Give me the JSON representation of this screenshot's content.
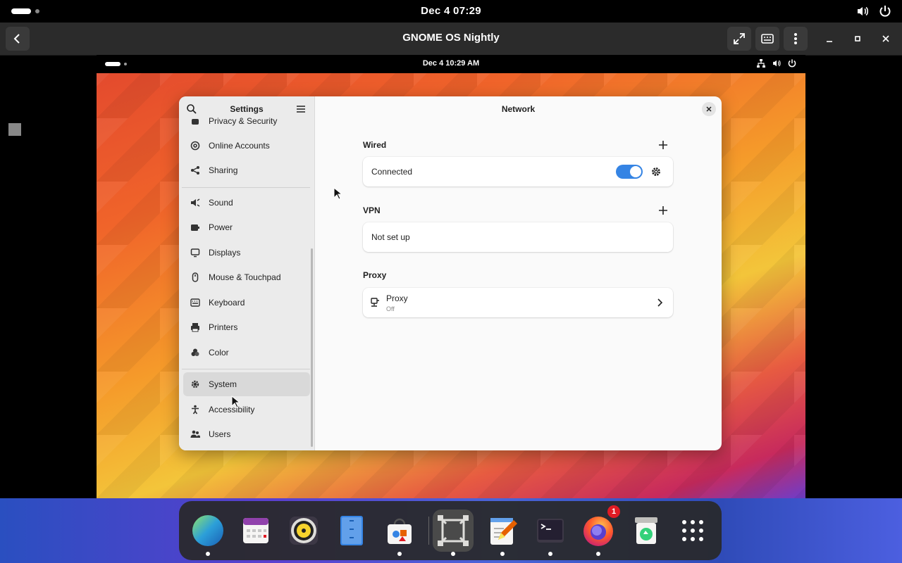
{
  "host_topbar": {
    "datetime": "Dec 4  07:29",
    "icons": [
      "activities-pill",
      "workspace-dot",
      "volume-icon",
      "power-icon"
    ]
  },
  "boxes_bar": {
    "title": "GNOME OS Nightly",
    "buttons": [
      "back-icon",
      "fullscreen-icon",
      "keyboard-icon",
      "menu-icon",
      "minimize-icon",
      "maximize-icon",
      "close-icon"
    ]
  },
  "vm_topbar": {
    "datetime": "Dec 4  10:29 AM",
    "icons": [
      "network-icon",
      "volume-icon",
      "power-icon"
    ]
  },
  "settings": {
    "sidebar_title": "Settings",
    "page_title": "Network",
    "sidebar_items": [
      {
        "label": "Privacy & Security",
        "icon": "hand-icon"
      },
      {
        "label": "Online Accounts",
        "icon": "at-icon"
      },
      {
        "label": "Sharing",
        "icon": "share-icon"
      },
      {
        "label": "Sound",
        "icon": "speaker-icon"
      },
      {
        "label": "Power",
        "icon": "battery-icon"
      },
      {
        "label": "Displays",
        "icon": "display-icon"
      },
      {
        "label": "Mouse & Touchpad",
        "icon": "mouse-icon"
      },
      {
        "label": "Keyboard",
        "icon": "keyboard-icon"
      },
      {
        "label": "Printers",
        "icon": "printer-icon"
      },
      {
        "label": "Color",
        "icon": "color-icon"
      },
      {
        "label": "System",
        "icon": "gear-icon"
      },
      {
        "label": "Accessibility",
        "icon": "accessibility-icon"
      },
      {
        "label": "Users",
        "icon": "users-icon"
      }
    ],
    "selected_item": "System",
    "sections": {
      "wired": {
        "title": "Wired",
        "row_label": "Connected",
        "toggle_on": true
      },
      "vpn": {
        "title": "VPN",
        "row_label": "Not set up"
      },
      "proxy": {
        "title": "Proxy",
        "row_label": "Proxy",
        "row_sublabel": "Off"
      }
    }
  },
  "dock": {
    "apps": [
      {
        "name": "Web Browser",
        "running": true
      },
      {
        "name": "Calendar",
        "running": false
      },
      {
        "name": "Rhythmbox",
        "running": false
      },
      {
        "name": "Files",
        "running": false
      },
      {
        "name": "Software",
        "running": true
      },
      {
        "name": "Boxes",
        "running": true,
        "active": true
      },
      {
        "name": "Text Editor",
        "running": true
      },
      {
        "name": "Terminal",
        "running": true
      },
      {
        "name": "Firefox",
        "running": true,
        "badge": "1"
      },
      {
        "name": "Trash",
        "running": false
      },
      {
        "name": "Show Apps",
        "running": false
      }
    ],
    "accent_color": "#3584e4"
  }
}
